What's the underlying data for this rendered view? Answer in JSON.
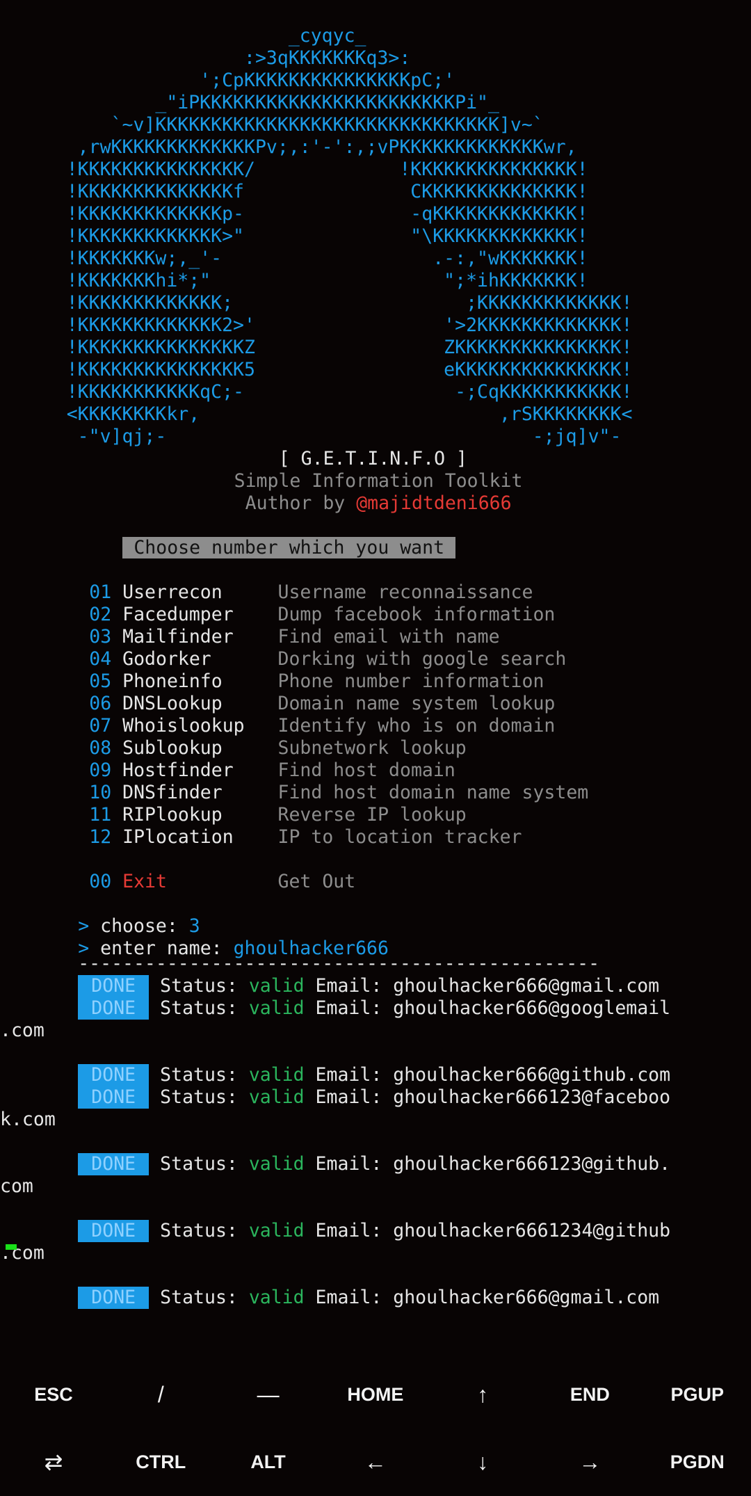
{
  "banner": {
    "art": [
      "                          _cyqyc_",
      "                      :>3qKKKKKKKq3>:",
      "                  ';CpKKKKKKKKKKKKKKKpC;'",
      "              _\"iPKKKKKKKKKKKKKKKKKKKKKKKPi\"_",
      "          `~v]KKKKKKKKKKKKKKKKKKKKKKKKKKKKKKK]v~`",
      "       ,rwKKKKKKKKKKKKKPv;,:'-':,;vPKKKKKKKKKKKKKwr,",
      "      !KKKKKKKKKKKKKKK/             !KKKKKKKKKKKKKKK!",
      "      !KKKKKKKKKKKKKKf               CKKKKKKKKKKKKKK!",
      "      !KKKKKKKKKKKKKp-               -qKKKKKKKKKKKKK!",
      "      !KKKKKKKKKKKKK>\"               \"\\KKKKKKKKKKKKK!",
      "      !KKKKKKKw;,_'-                   .-:,\"wKKKKKKK!",
      "      !KKKKKKKhi*;\"                     \";*ihKKKKKKK!",
      "      !KKKKKKKKKKKKK;                     ;KKKKKKKKKKKKK!",
      "      !KKKKKKKKKKKKK2>'                 '>2KKKKKKKKKKKKK!",
      "      !KKKKKKKKKKKKKKKZ                 ZKKKKKKKKKKKKKKK!",
      "      !KKKKKKKKKKKKKKK5                 eKKKKKKKKKKKKKKK!",
      "      !KKKKKKKKKKKqC;-                   -;CqKKKKKKKKKKK!",
      "      <KKKKKKKKkr,                           ,rSKKKKKKKK<",
      "       -\"v]qj;-                                 -;jq]v\"-"
    ],
    "title": "[ G.E.T.I.N.F.O ]",
    "subtitle": "Simple Information Toolkit",
    "author_prefix": "Author by ",
    "author_handle": "@majidtdeni666"
  },
  "prompt_header": "Choose number which you want",
  "menu": [
    {
      "num": "01",
      "name": "Userrecon",
      "desc": "Username reconnaissance"
    },
    {
      "num": "02",
      "name": "Facedumper",
      "desc": "Dump facebook information"
    },
    {
      "num": "03",
      "name": "Mailfinder",
      "desc": "Find email with name"
    },
    {
      "num": "04",
      "name": "Godorker",
      "desc": "Dorking with google search"
    },
    {
      "num": "05",
      "name": "Phoneinfo",
      "desc": "Phone number information"
    },
    {
      "num": "06",
      "name": "DNSLookup",
      "desc": "Domain name system lookup"
    },
    {
      "num": "07",
      "name": "Whoislookup",
      "desc": "Identify who is on domain"
    },
    {
      "num": "08",
      "name": "Sublookup",
      "desc": "Subnetwork lookup"
    },
    {
      "num": "09",
      "name": "Hostfinder",
      "desc": "Find host domain"
    },
    {
      "num": "10",
      "name": "DNSfinder",
      "desc": "Find host domain name system"
    },
    {
      "num": "11",
      "name": "RIPlookup",
      "desc": "Reverse IP lookup"
    },
    {
      "num": "12",
      "name": "IPlocation",
      "desc": "IP to location tracker"
    }
  ],
  "exit_item": {
    "num": "00",
    "name": "Exit",
    "desc": "Get Out"
  },
  "session": {
    "prompt_symbol": ">",
    "choose_label": "choose: ",
    "choose_value": "3",
    "name_label": "enter name: ",
    "name_value": "ghoulhacker666",
    "separator": "-----------------------------------------------"
  },
  "results": [
    {
      "badge": "DONE",
      "status_label": "Status: ",
      "status": "valid",
      "email_label": " Email: ",
      "email": "ghoulhacker666@gmail.com",
      "wrap": ""
    },
    {
      "badge": "DONE",
      "status_label": "Status: ",
      "status": "valid",
      "email_label": " Email: ",
      "email": "ghoulhacker666@googlemail",
      "wrap": ".com"
    },
    {
      "badge": "DONE",
      "status_label": "Status: ",
      "status": "valid",
      "email_label": " Email: ",
      "email": "ghoulhacker666@github.com",
      "wrap": ""
    },
    {
      "badge": "DONE",
      "status_label": "Status: ",
      "status": "valid",
      "email_label": " Email: ",
      "email": "ghoulhacker666123@faceboo",
      "wrap": "k.com"
    },
    {
      "badge": "DONE",
      "status_label": "Status: ",
      "status": "valid",
      "email_label": " Email: ",
      "email": "ghoulhacker666123@github.",
      "wrap": "com"
    },
    {
      "badge": "DONE",
      "status_label": "Status: ",
      "status": "valid",
      "email_label": " Email: ",
      "email": "ghoulhacker6661234@github",
      "wrap": ".com"
    },
    {
      "badge": "DONE",
      "status_label": "Status: ",
      "status": "valid",
      "email_label": " Email: ",
      "email": "ghoulhacker666@gmail.com",
      "wrap": ""
    }
  ],
  "extra_keys": {
    "row1": [
      "ESC",
      "/",
      "—",
      "HOME",
      "↑",
      "END",
      "PGUP"
    ],
    "row2": [
      "⇄",
      "CTRL",
      "ALT",
      "←",
      "↓",
      "→",
      "PGDN"
    ],
    "row1_names": [
      "esc-key",
      "slash-key",
      "dash-key",
      "home-key",
      "arrow-up-key",
      "end-key",
      "page-up-key"
    ],
    "row2_names": [
      "switch-keyboard-icon",
      "ctrl-key",
      "alt-key",
      "arrow-left-key",
      "arrow-down-key",
      "arrow-right-key",
      "page-down-key"
    ]
  },
  "colors": {
    "background": "#080404",
    "accent_blue": "#1c9be6",
    "muted_grey": "#8d8d8d",
    "exit_red": "#e53a35",
    "valid_green": "#2bb55d",
    "cursor_green": "#19e019"
  }
}
